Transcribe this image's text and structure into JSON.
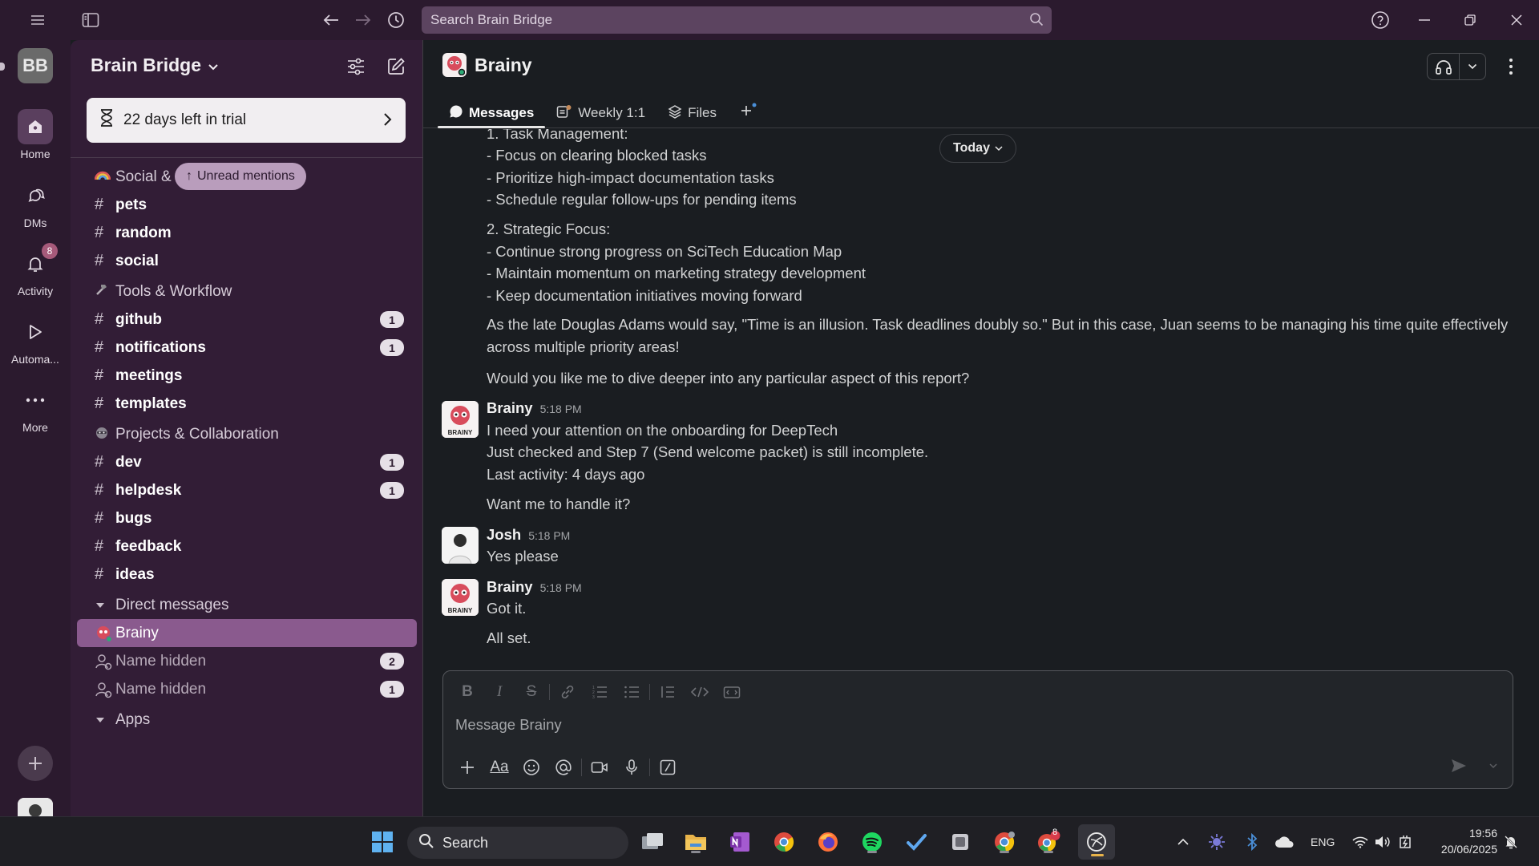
{
  "search": {
    "placeholder": "Search Brain Bridge"
  },
  "rail": {
    "workspace_initials": "BB",
    "items": [
      {
        "label": "Home",
        "icon": "home-icon"
      },
      {
        "label": "DMs",
        "icon": "dms-icon"
      },
      {
        "label": "Activity",
        "icon": "bell-icon",
        "badge": "8"
      },
      {
        "label": "Automa...",
        "icon": "play-icon"
      },
      {
        "label": "More",
        "icon": "more-icon"
      }
    ]
  },
  "sidebar": {
    "workspace_name": "Brain Bridge",
    "trial_text": "22 days left in trial",
    "unread_mentions": "Unread mentions",
    "rows": [
      {
        "type": "section",
        "label": "Social &",
        "icon": "rainbow-emoji-icon"
      },
      {
        "type": "channel",
        "label": "pets"
      },
      {
        "type": "channel",
        "label": "random"
      },
      {
        "type": "channel",
        "label": "social"
      },
      {
        "type": "section",
        "label": "Tools & Workflow",
        "icon": "hammer-emoji-icon"
      },
      {
        "type": "channel",
        "label": "github",
        "count": "1"
      },
      {
        "type": "channel",
        "label": "notifications",
        "count": "1"
      },
      {
        "type": "channel",
        "label": "meetings"
      },
      {
        "type": "channel",
        "label": "templates"
      },
      {
        "type": "section",
        "label": "Projects & Collaboration",
        "icon": "raccoon-emoji-icon"
      },
      {
        "type": "channel",
        "label": "dev",
        "count": "1"
      },
      {
        "type": "channel",
        "label": "helpdesk",
        "count": "1"
      },
      {
        "type": "channel",
        "label": "bugs"
      },
      {
        "type": "channel",
        "label": "feedback"
      },
      {
        "type": "channel",
        "label": "ideas"
      },
      {
        "type": "collapse",
        "label": "Direct messages"
      },
      {
        "type": "dm-active",
        "label": "Brainy"
      },
      {
        "type": "dm",
        "label": "Name hidden",
        "count": "2"
      },
      {
        "type": "dm",
        "label": "Name hidden",
        "count": "1"
      },
      {
        "type": "collapse",
        "label": "Apps"
      }
    ]
  },
  "channel": {
    "title": "Brainy",
    "tabs": [
      {
        "label": "Messages",
        "icon": "message-bubble-icon"
      },
      {
        "label": "Weekly 1:1",
        "icon": "canvas-icon"
      },
      {
        "label": "Files",
        "icon": "layers-icon"
      }
    ],
    "date_divider": "Today"
  },
  "messages": {
    "report": {
      "task_header": "1. Task Management:",
      "task_items": [
        "- Focus on clearing blocked tasks",
        "- Prioritize high-impact documentation tasks",
        "- Schedule regular follow-ups for pending items"
      ],
      "strategic_header": "2. Strategic Focus:",
      "strategic_items": [
        "- Continue strong progress on SciTech Education Map",
        "- Maintain momentum on marketing strategy development",
        "- Keep documentation initiatives moving forward"
      ],
      "quote": "As the late Douglas Adams would say, \"Time is an illusion. Task deadlines doubly so.\" But in this case, Juan seems to be managing his time quite effectively across multiple priority areas!",
      "question": "Would you like me to dive deeper into any particular aspect of this report?"
    },
    "m1": {
      "author": "Brainy",
      "time": "5:18 PM",
      "lines": [
        "I need your attention on the onboarding for DeepTech",
        "Just checked and Step 7 (Send welcome packet) is still incomplete.",
        "Last activity: 4 days ago"
      ],
      "follow": "Want me to handle it?"
    },
    "m2": {
      "author": "Josh",
      "time": "5:18 PM",
      "text": "Yes please"
    },
    "m3": {
      "author": "Brainy",
      "time": "5:18 PM",
      "text": "Got it.",
      "follow": "All set."
    },
    "avatar_caption": "BRAINY"
  },
  "composer": {
    "placeholder": "Message Brainy"
  },
  "taskbar": {
    "search_placeholder": "Search",
    "lang": "ENG",
    "time": "19:56",
    "date": "20/06/2025",
    "chrome_badge": "8"
  },
  "colors": {
    "accent": "#8a5a8e",
    "rail": "#2b1a2e",
    "sidebar": "#321d36",
    "main": "#1a1d21"
  }
}
